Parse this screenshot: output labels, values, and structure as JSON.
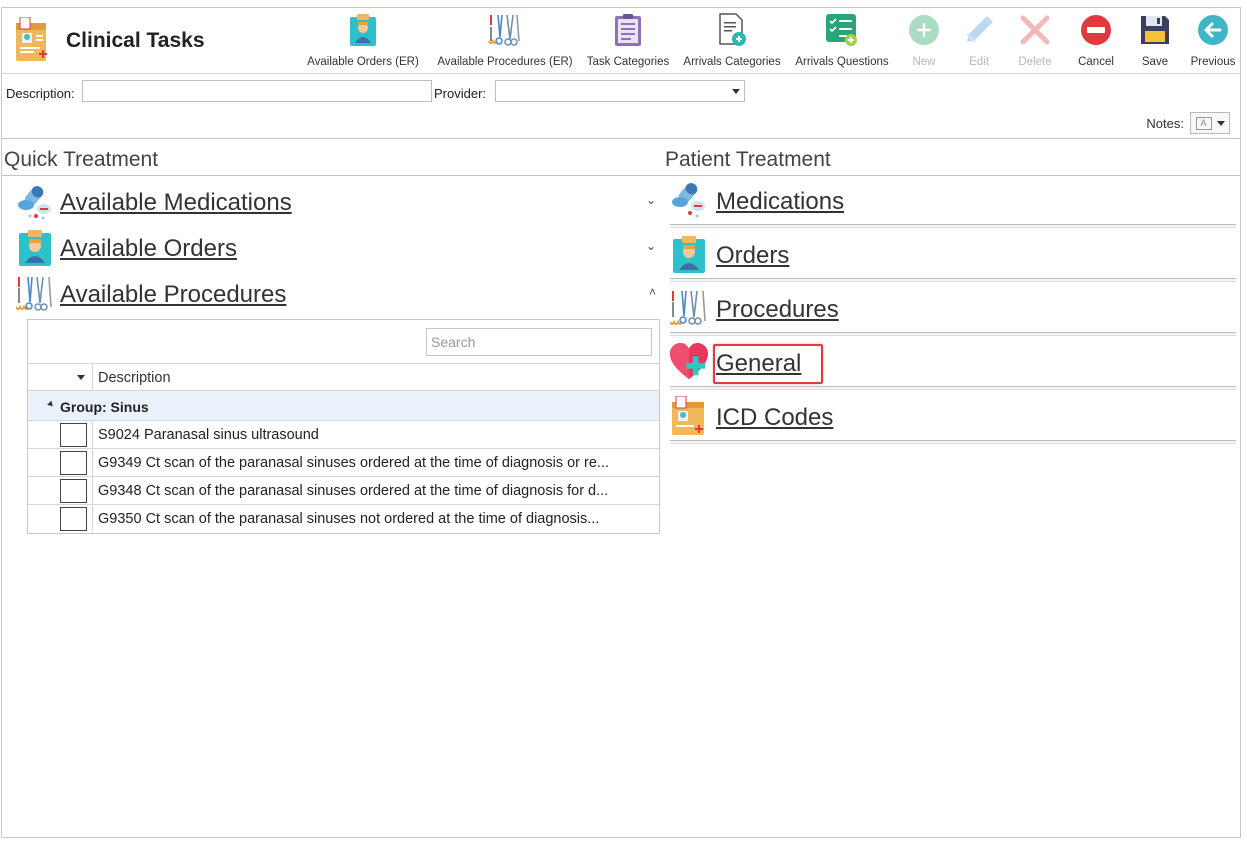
{
  "app": {
    "title": "Clinical Tasks",
    "icon": "clinical-record-icon"
  },
  "toolbar": {
    "available_orders_er": "Available Orders (ER)",
    "available_procedures_er": "Available Procedures (ER)",
    "task_categories": "Task Categories",
    "arrivals_categories": "Arrivals Categories",
    "arrivals_questions": "Arrivals Questions",
    "new": "New",
    "edit": "Edit",
    "delete": "Delete",
    "cancel": "Cancel",
    "save": "Save",
    "previous": "Previous"
  },
  "filters": {
    "description_label": "Description:",
    "description_value": "",
    "provider_label": "Provider:",
    "provider_value": "",
    "notes_label": "Notes:"
  },
  "quick_treatment": {
    "title": "Quick Treatment",
    "items": [
      {
        "label": "Available Medications",
        "icon": "medications-icon",
        "expanded": false
      },
      {
        "label": "Available Orders",
        "icon": "orders-icon",
        "expanded": false
      },
      {
        "label": "Available Procedures",
        "icon": "procedures-icon",
        "expanded": true
      }
    ],
    "grid": {
      "search_placeholder": "Search",
      "column_description": "Description",
      "group_label": "Group: Sinus",
      "rows": [
        "S9024 Paranasal sinus ultrasound",
        "G9349 Ct scan of the paranasal sinuses ordered at the time of diagnosis or re...",
        "G9348 Ct scan of the paranasal sinuses ordered at the time of diagnosis for d...",
        "G9350 Ct scan of the paranasal sinuses not ordered at the time of diagnosis..."
      ]
    }
  },
  "patient_treatment": {
    "title": "Patient Treatment",
    "items": [
      {
        "label": "Medications",
        "icon": "medications-icon"
      },
      {
        "label": "Orders",
        "icon": "orders-icon"
      },
      {
        "label": "Procedures",
        "icon": "procedures-icon"
      },
      {
        "label": "General",
        "icon": "heart-plus-icon",
        "highlighted": true
      },
      {
        "label": "ICD Codes",
        "icon": "icd-codes-icon"
      }
    ]
  },
  "colors": {
    "highlight": "#e0393e",
    "group_row_bg": "#e9f1fa",
    "divider": "#b9c6d3"
  }
}
